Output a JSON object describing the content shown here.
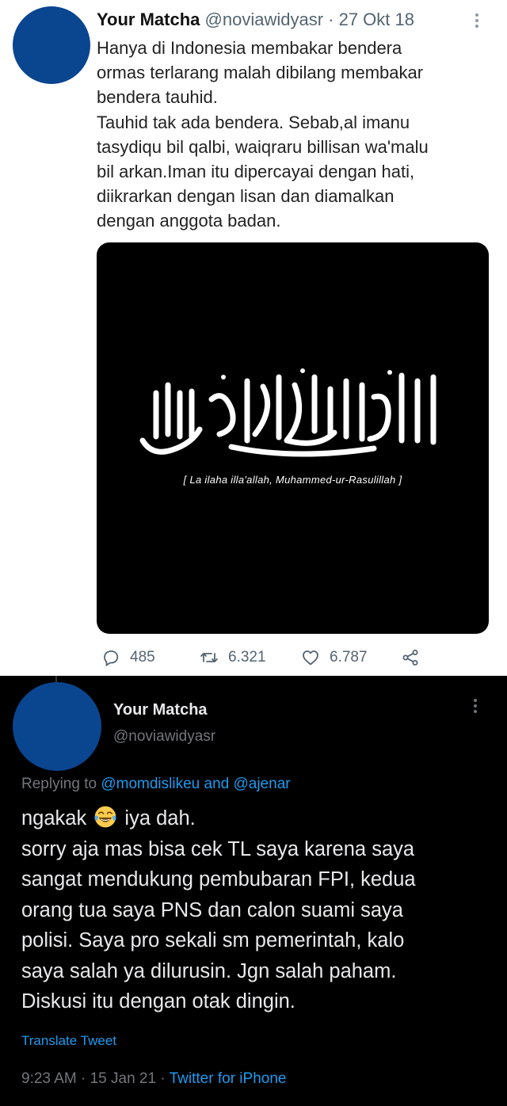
{
  "quoted_tweet": {
    "display_name": "Your Matcha",
    "handle": "@noviawidyasr",
    "separator": "·",
    "date": "27 Okt 18",
    "body_lines": [
      "Hanya di Indonesia membakar bendera",
      "ormas terlarang malah dibilang membakar",
      "bendera tauhid.",
      "Tauhid tak ada bendera. Sebab,al imanu",
      "tasydiqu bil qalbi, waiqraru billisan wa'malu",
      "bil arkan.Iman itu dipercayai dengan hati,",
      "diikrarkan dengan lisan dan diamalkan",
      "dengan anggota badan."
    ],
    "image_caption": "[ La ilaha illa'allah, Muhammed-ur-Rasulillah ]",
    "reply_count": "485",
    "retweet_count": "6.321",
    "like_count": "6.787",
    "avatar_color": "#0a4590"
  },
  "reply_tweet": {
    "display_name": "Your Matcha",
    "handle": "@noviawidyasr",
    "replying_prefix": "Replying to ",
    "mention_1": "@momdislikeu",
    "and_word": " and ",
    "mention_2": "@ajenar",
    "first_line_before_emoji": "ngakak",
    "emoji_name": "face-with-tears-of-joy",
    "first_line_after_emoji": "iya dah.",
    "body_lines": [
      "sorry aja mas bisa cek TL saya karena saya",
      "sangat mendukung pembubaran FPI, kedua",
      "orang tua saya PNS dan calon suami saya",
      "polisi. Saya pro sekali sm pemerintah, kalo",
      "saya salah ya dilurusin. Jgn salah paham.",
      "Diskusi itu dengan otak dingin."
    ],
    "translate_label": "Translate Tweet",
    "time": "9:23 AM",
    "separator": "·",
    "date": "15 Jan 21",
    "source": "Twitter for iPhone",
    "link_color": "#1d9bf0",
    "avatar_color": "#0a4590"
  }
}
